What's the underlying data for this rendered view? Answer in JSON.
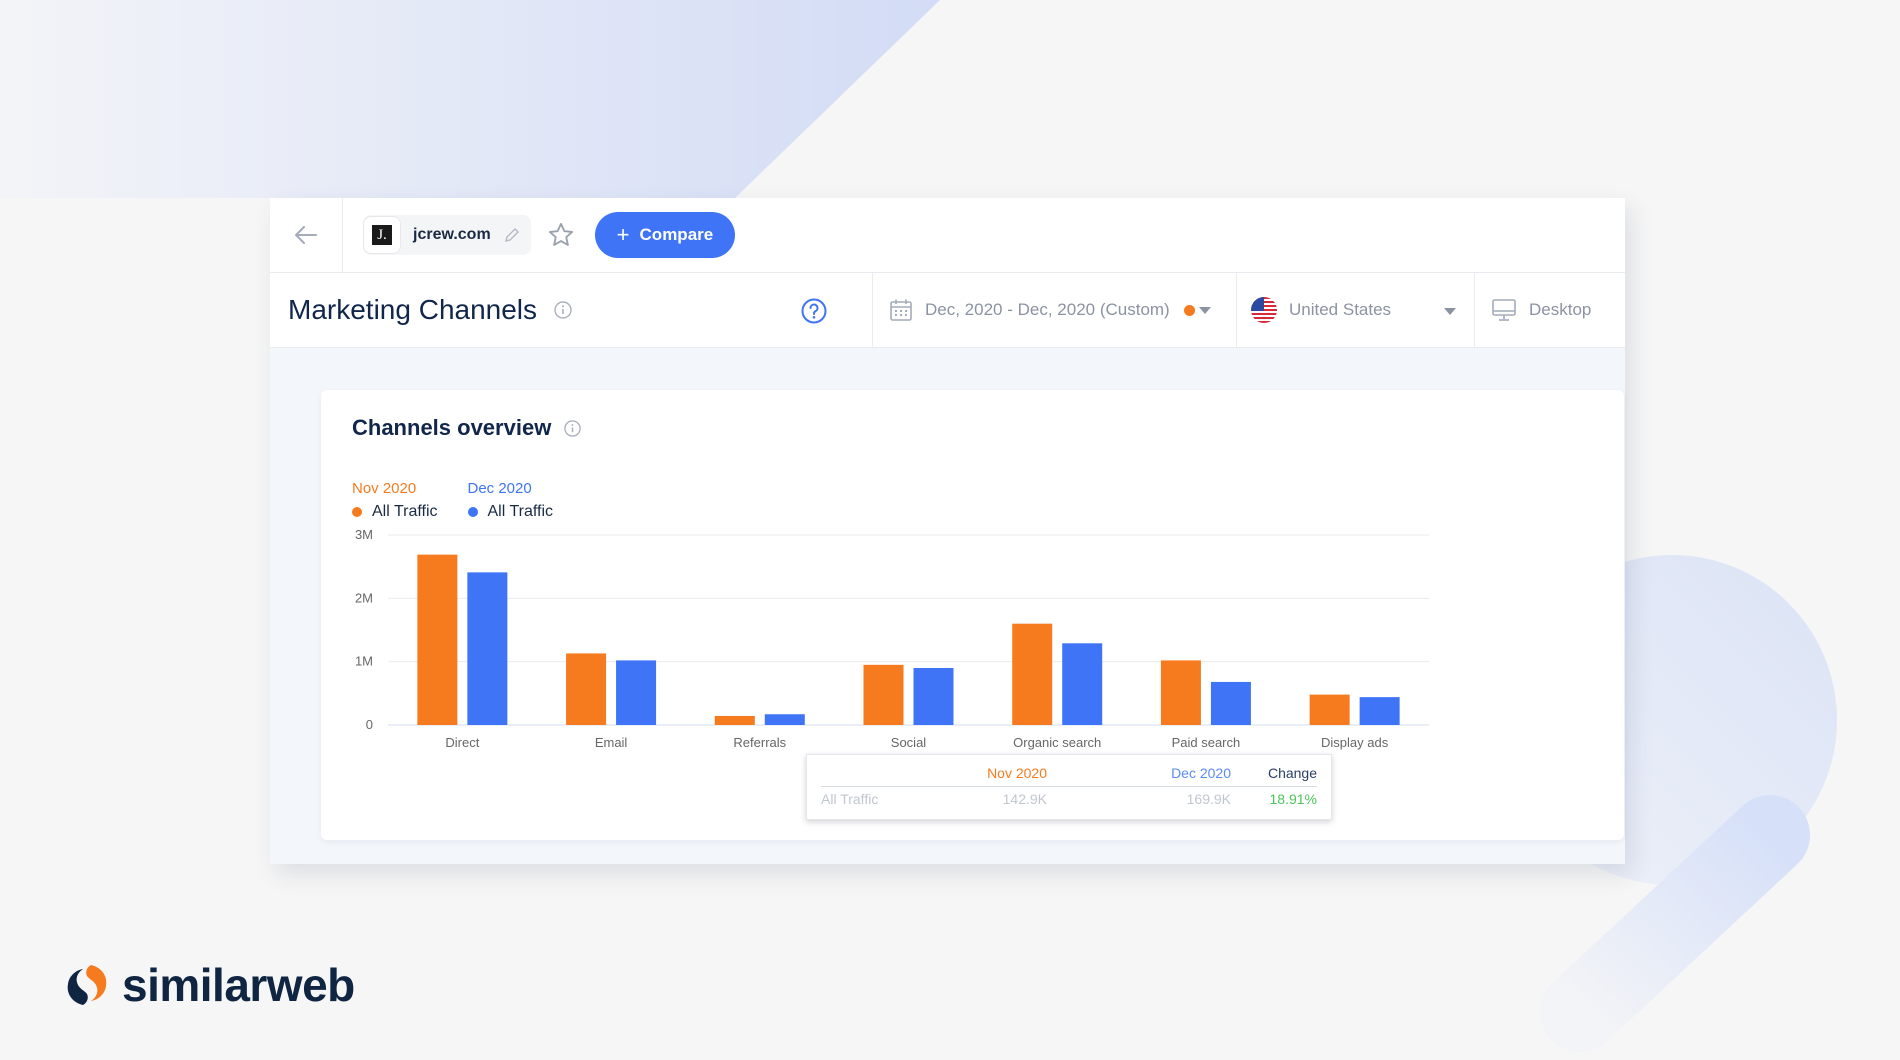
{
  "header": {
    "site": "jcrew.com",
    "favicon_letter": "J.",
    "compare_label": "Compare",
    "compare_icon": "plus-icon"
  },
  "subheader": {
    "title": "Marketing Channels",
    "date_range": "Dec, 2020 - Dec, 2020 (Custom)",
    "country": "United States",
    "device": "Desktop"
  },
  "card": {
    "title": "Channels overview",
    "legend": [
      {
        "period": "Nov 2020",
        "series": "All Traffic",
        "color": "#f67b1f"
      },
      {
        "period": "Dec 2020",
        "series": "All Traffic",
        "color": "#3e74f5"
      }
    ]
  },
  "tooltip": {
    "headers": [
      "",
      "Nov 2020",
      "Dec 2020",
      "Change"
    ],
    "row": {
      "label": "All Traffic",
      "nov": "142.9K",
      "dec": "169.9K",
      "change": "18.91%"
    },
    "colors": {
      "nov": "#f67b1f",
      "dec": "#5a8cf6",
      "change_header": "#2c3e66",
      "change": "#4ec45a"
    }
  },
  "brand": {
    "name": "similarweb",
    "accent": "#f67b1f",
    "navy": "#0f2542"
  },
  "chart_data": {
    "type": "bar",
    "title": "Channels overview",
    "xlabel": "",
    "ylabel": "",
    "categories": [
      "Direct",
      "Email",
      "Referrals",
      "Social",
      "Organic search",
      "Paid search",
      "Display ads"
    ],
    "series": [
      {
        "name": "Nov 2020 - All Traffic",
        "color": "#f67b1f",
        "values": [
          2690000,
          1130000,
          142900,
          950000,
          1600000,
          1020000,
          480000
        ]
      },
      {
        "name": "Dec 2020 - All Traffic",
        "color": "#3e74f5",
        "values": [
          2410000,
          1020000,
          169900,
          900000,
          1290000,
          680000,
          440000
        ]
      }
    ],
    "yticks": [
      0,
      1000000,
      2000000,
      3000000
    ],
    "ytick_labels": [
      "0",
      "1M",
      "2M",
      "3M"
    ],
    "ylim": [
      0,
      3000000
    ],
    "grid": true,
    "legend_position": "top-left"
  }
}
